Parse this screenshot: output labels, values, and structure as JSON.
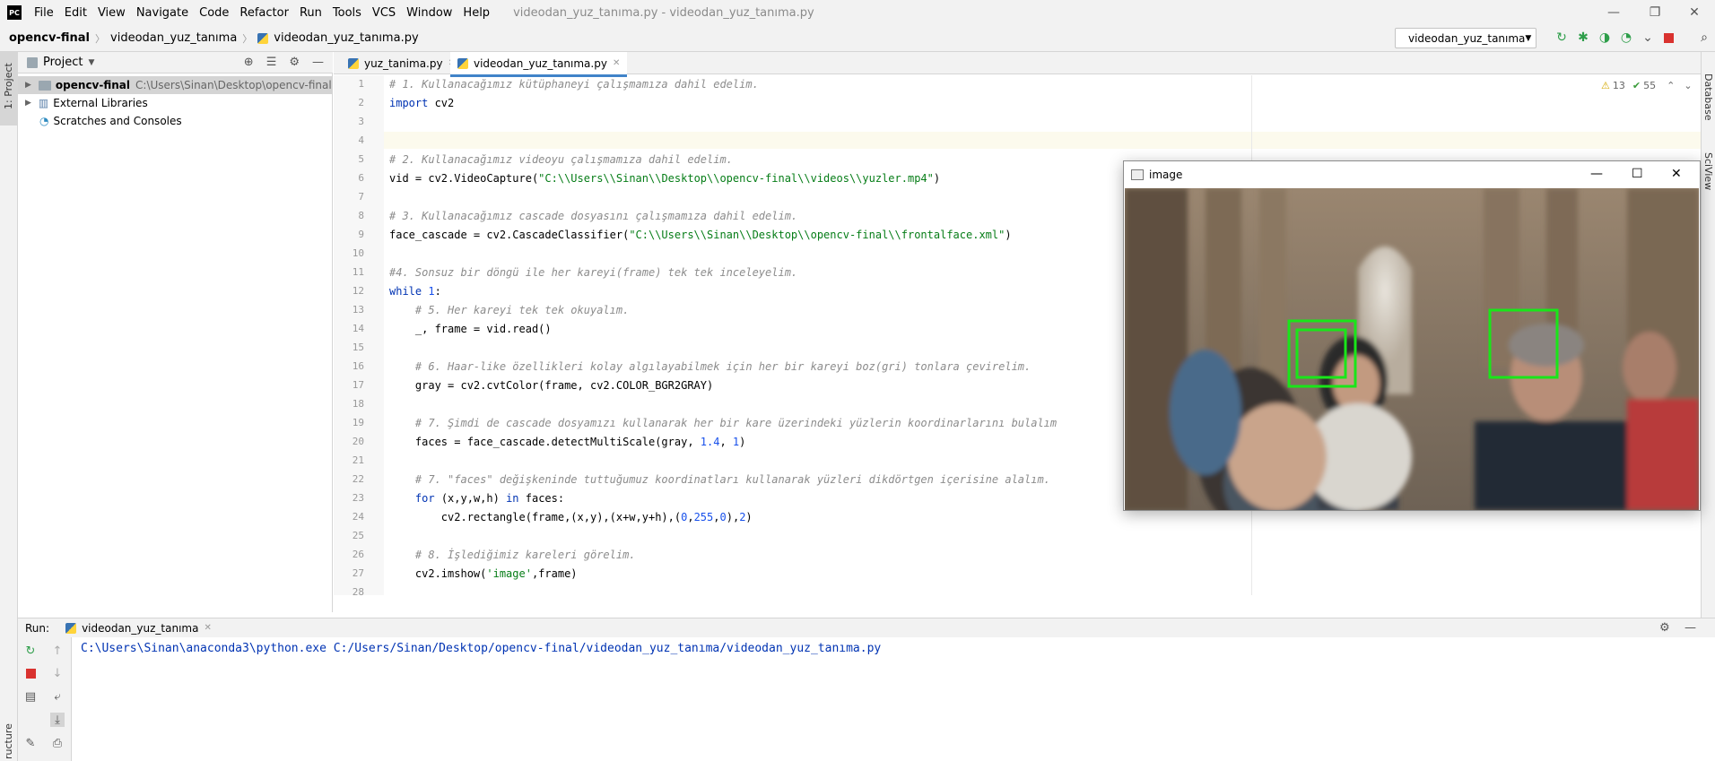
{
  "menu": [
    "File",
    "Edit",
    "View",
    "Navigate",
    "Code",
    "Refactor",
    "Run",
    "Tools",
    "VCS",
    "Window",
    "Help"
  ],
  "window_title": "videodan_yuz_tanıma.py - videodan_yuz_tanıma.py",
  "breadcrumbs": [
    "opencv-final",
    "videodan_yuz_tanıma",
    "videodan_yuz_tanıma.py"
  ],
  "run_config": "videodan_yuz_tanıma",
  "project": {
    "title": "Project",
    "root_name": "opencv-final",
    "root_path": "C:\\Users\\Sinan\\Desktop\\opencv-final",
    "external": "External Libraries",
    "scratches": "Scratches and Consoles"
  },
  "side_tabs": {
    "left_top": "1: Project",
    "left_bottom": "ructure",
    "right_top": "Database",
    "right_bottom": "SciView"
  },
  "tabs": [
    "yuz_tanima.py",
    "videodan_yuz_tanıma.py"
  ],
  "inspection": {
    "warnings": "13",
    "ok": "55"
  },
  "code_lines": [
    {
      "n": "1",
      "t": "# 1. Kullanacağımız kütüphaneyi çalışmamıza dahil edelim."
    },
    {
      "n": "2",
      "t": "import cv2"
    },
    {
      "n": "3",
      "t": ""
    },
    {
      "n": "4",
      "t": ""
    },
    {
      "n": "5",
      "t": "# 2. Kullanacağımız videoyu çalışmamıza dahil edelim."
    },
    {
      "n": "6",
      "t": "vid = cv2.VideoCapture(\"C:\\\\Users\\\\Sinan\\\\Desktop\\\\opencv-final\\\\videos\\\\yuzler.mp4\")"
    },
    {
      "n": "7",
      "t": ""
    },
    {
      "n": "8",
      "t": "# 3. Kullanacağımız cascade dosyasını çalışmamıza dahil edelim."
    },
    {
      "n": "9",
      "t": "face_cascade = cv2.CascadeClassifier(\"C:\\\\Users\\\\Sinan\\\\Desktop\\\\opencv-final\\\\frontalface.xml\")"
    },
    {
      "n": "10",
      "t": ""
    },
    {
      "n": "11",
      "t": "#4. Sonsuz bir döngü ile her kareyi(frame) tek tek inceleyelim."
    },
    {
      "n": "12",
      "t": "while 1:"
    },
    {
      "n": "13",
      "t": "    # 5. Her kareyi tek tek okuyalım."
    },
    {
      "n": "14",
      "t": "    _, frame = vid.read()"
    },
    {
      "n": "15",
      "t": ""
    },
    {
      "n": "16",
      "t": "    # 6. Haar-like özellikleri kolay algılayabilmek için her bir kareyi boz(gri) tonlara çevirelim."
    },
    {
      "n": "17",
      "t": "    gray = cv2.cvtColor(frame, cv2.COLOR_BGR2GRAY)"
    },
    {
      "n": "18",
      "t": ""
    },
    {
      "n": "19",
      "t": "    # 7. Şimdi de cascade dosyamızı kullanarak her bir kare üzerindeki yüzlerin koordinarlarını bulalım"
    },
    {
      "n": "20",
      "t": "    faces = face_cascade.detectMultiScale(gray, 1.4, 1)"
    },
    {
      "n": "21",
      "t": ""
    },
    {
      "n": "22",
      "t": "    # 7. \"faces\" değişkeninde tuttuğumuz koordinatları kullanarak yüzleri dikdörtgen içerisine alalım."
    },
    {
      "n": "23",
      "t": "    for (x,y,w,h) in faces:"
    },
    {
      "n": "24",
      "t": "        cv2.rectangle(frame,(x,y),(x+w,y+h),(0,255,0),2)"
    },
    {
      "n": "25",
      "t": ""
    },
    {
      "n": "26",
      "t": "    # 8. İşlediğimiz kareleri görelim."
    },
    {
      "n": "27",
      "t": "    cv2.imshow('image',frame)"
    },
    {
      "n": "28",
      "t": ""
    }
  ],
  "image_window": {
    "title": "image"
  },
  "run": {
    "label": "Run:",
    "tab": "videodan_yuz_tanıma",
    "output": "C:\\Users\\Sinan\\anaconda3\\python.exe C:/Users/Sinan/Desktop/opencv-final/videodan_yuz_tanıma/videodan_yuz_tanıma.py"
  },
  "colors": {
    "comment": "#8c8c8c",
    "keyword": "#0033b3",
    "string": "#067d17",
    "number": "#1750eb",
    "face_box": "#19e619"
  }
}
